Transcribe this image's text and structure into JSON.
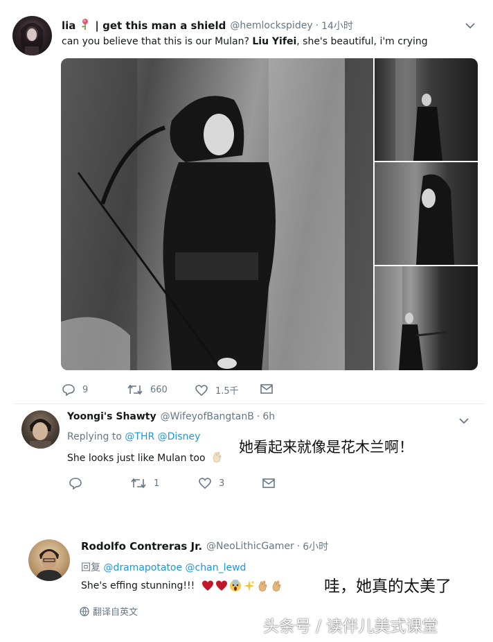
{
  "tweet1": {
    "display_name": "lia",
    "display_name_suffix": "| get this man a shield",
    "handle": "@hemlockspidey",
    "separator": "·",
    "time": "14小时",
    "text_before": "can you believe that this is our Mulan? ",
    "text_bold": "Liu Yifei",
    "text_after": ", she's beautiful, i'm crying",
    "actions": {
      "replies": "9",
      "retweets": "660",
      "likes": "1.5千"
    }
  },
  "tweet2": {
    "display_name": "Yoongi's Shawty",
    "handle": "@WifeyofBangtanB",
    "separator": "·",
    "time": "6h",
    "replying_prefix": "Replying to ",
    "replying_mention1": "@THR",
    "replying_mention2": "@Disney",
    "text": "She looks just like Mulan too",
    "cn_translation": "她看起来就像是花木兰啊！",
    "actions": {
      "replies": "",
      "retweets": "1",
      "likes": "3"
    }
  },
  "tweet3": {
    "display_name": "Rodolfo Contreras Jr.",
    "handle": "@NeoLithicGamer",
    "separator": "·",
    "time": "6小时",
    "reply_prefix": "回复 ",
    "reply_mention1": "@dramapotatoe",
    "reply_mention2": "@chan_lewd",
    "text": "She's effing stunning!!!",
    "cn_translation": "哇，她真的太美了",
    "translate_label": "翻译自英文"
  },
  "watermark": "头条号 / 读伴儿美式课堂",
  "icons": [
    "chevron-down-icon",
    "reply-icon",
    "retweet-icon",
    "like-icon",
    "dm-icon",
    "globe-icon",
    "rose-icon",
    "clap-icon",
    "heart-icon",
    "scream-icon",
    "sparkles-icon"
  ],
  "colors": {
    "link": "#1b95e0",
    "muted": "#657786",
    "text": "#14171a"
  }
}
